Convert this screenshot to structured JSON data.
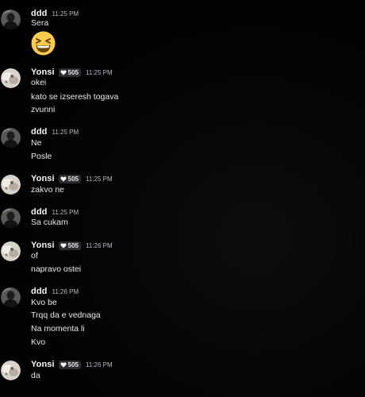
{
  "chat": {
    "groups": [
      {
        "author": "ddd",
        "avatar": "dark-avatar",
        "timestamp": "11:25 PM",
        "lines": [
          "Sera"
        ],
        "emoji": "grinning-squinting-face"
      },
      {
        "author": "Yonsi",
        "avatar": "light-avatar",
        "badge_icon": "heart-icon",
        "badge_count": "505",
        "timestamp": "11:25 PM",
        "lines": [
          "okei",
          "kato se izseresh togava",
          "zvunni"
        ]
      },
      {
        "author": "ddd",
        "avatar": "dark-avatar",
        "timestamp": "11:25 PM",
        "lines": [
          "Ne",
          "Posle"
        ]
      },
      {
        "author": "Yonsi",
        "avatar": "light-avatar",
        "badge_icon": "heart-icon",
        "badge_count": "505",
        "timestamp": "11:25 PM",
        "lines": [
          "zakvo ne"
        ]
      },
      {
        "author": "ddd",
        "avatar": "dark-avatar",
        "timestamp": "11:25 PM",
        "lines": [
          "Sa cukam"
        ]
      },
      {
        "author": "Yonsi",
        "avatar": "light-avatar",
        "badge_icon": "heart-icon",
        "badge_count": "505",
        "timestamp": "11:26 PM",
        "lines": [
          "of",
          "napravo ostei"
        ]
      },
      {
        "author": "ddd",
        "avatar": "dark-avatar",
        "timestamp": "11:26 PM",
        "lines": [
          "Kvo be",
          "Trqq da e vednaga",
          "Na momenta li",
          "Kvo"
        ]
      },
      {
        "author": "Yonsi",
        "avatar": "light-avatar",
        "badge_icon": "heart-icon",
        "badge_count": "505",
        "timestamp": "11:26 PM",
        "lines": [
          "da"
        ]
      }
    ]
  },
  "colors": {
    "background": "#000000",
    "username": "#f2f3f5",
    "message_text": "#e6e8ea",
    "timestamp": "#b5bac1",
    "badge_bg": "#2b2d31"
  }
}
